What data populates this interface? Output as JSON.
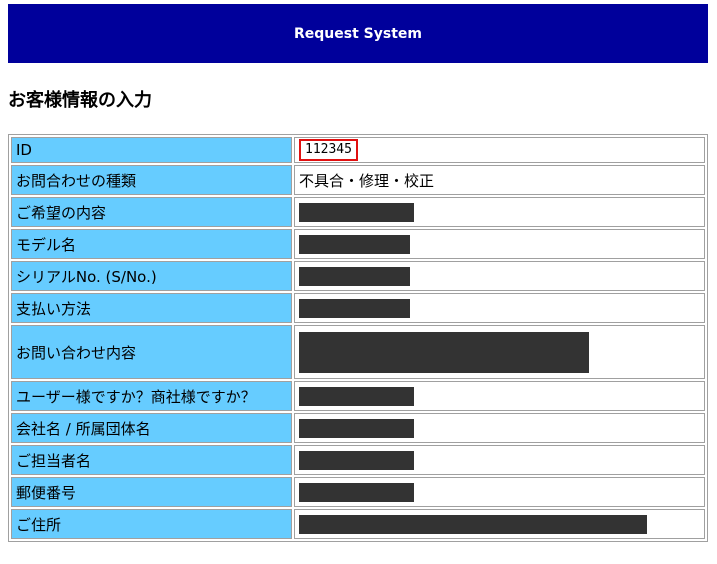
{
  "header": {
    "title": "Request System"
  },
  "page": {
    "title": "お客様情報の入力"
  },
  "form": {
    "rows": [
      {
        "label": "ID",
        "value": "112345"
      },
      {
        "label": "お問合わせの種類",
        "value": "不具合・修理・校正"
      },
      {
        "label": "ご希望の内容",
        "value": null
      },
      {
        "label": "モデル名",
        "value": null
      },
      {
        "label": "シリアルNo. (S/No.)",
        "value": null
      },
      {
        "label": "支払い方法",
        "value": null
      },
      {
        "label": "お問い合わせ内容",
        "value": null
      },
      {
        "label": "ユーザー様ですか？商社様ですか？",
        "value": null
      },
      {
        "label": "会社名 / 所属団体名",
        "value": null
      },
      {
        "label": "ご担当者名",
        "value": null
      },
      {
        "label": "郵便番号",
        "value": null
      },
      {
        "label": "ご住所",
        "value": null
      }
    ]
  },
  "colors": {
    "header_bg": "#00009b",
    "label_bg": "#66ccff",
    "id_highlight": "#e01010",
    "redaction": "#333333"
  }
}
